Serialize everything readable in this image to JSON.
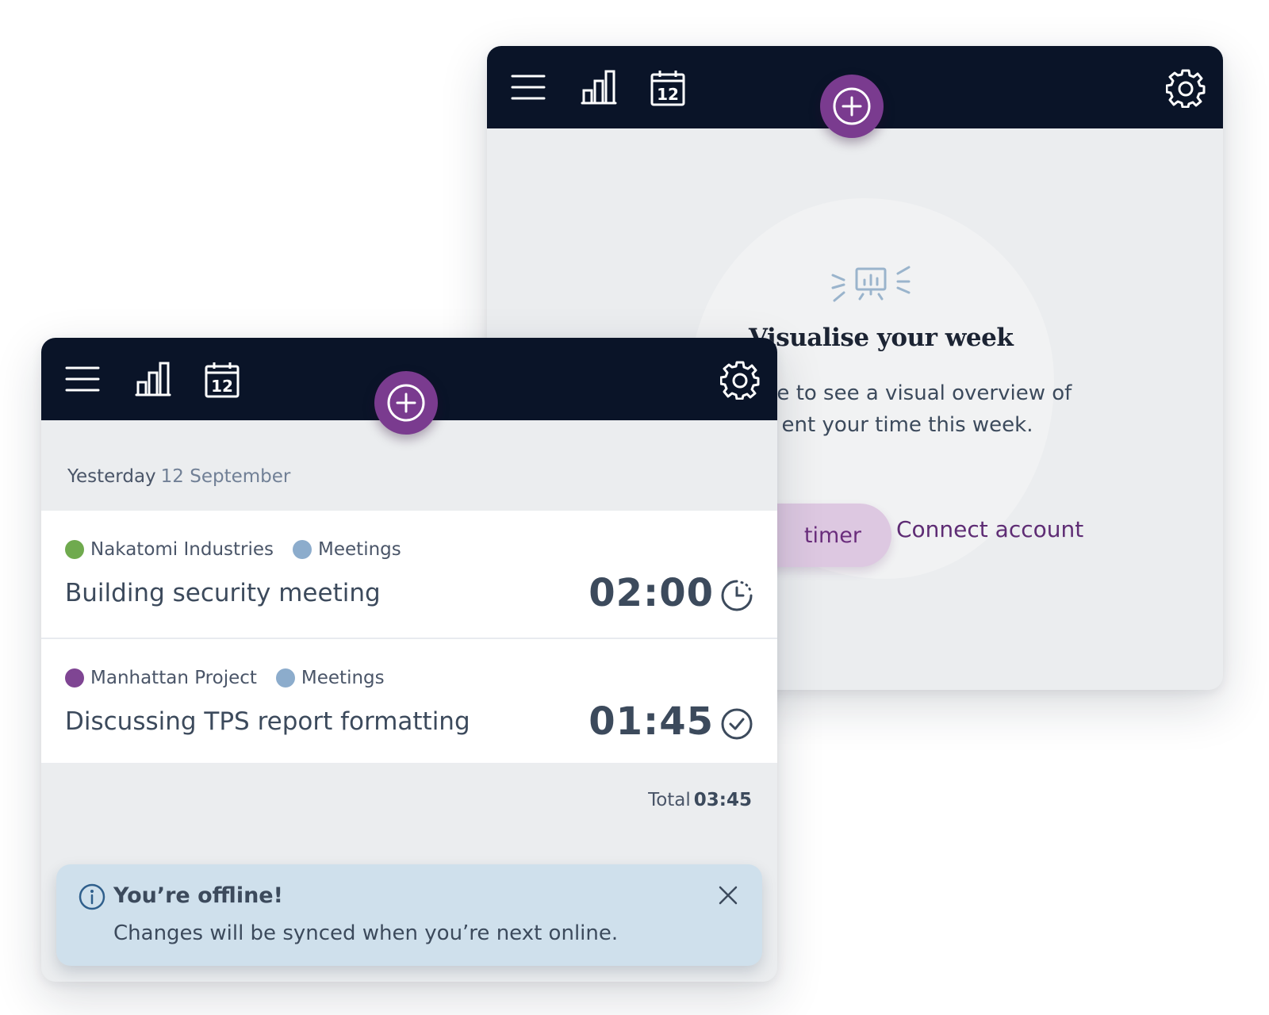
{
  "back_window": {
    "topbar": {
      "icons": [
        "menu-icon",
        "stats-icon",
        "calendar-icon",
        "add-icon",
        "gear-icon"
      ],
      "calendar_day": "12"
    },
    "empty_state": {
      "icon": "presentation-icon",
      "title": "Visualise your week",
      "text_line1": "time to see a visual overview of",
      "text_line2": "ent your time this week.",
      "primary_button": "timer",
      "link": "Connect account"
    }
  },
  "front_window": {
    "topbar": {
      "icons": [
        "menu-icon",
        "stats-icon",
        "calendar-icon",
        "add-icon",
        "gear-icon"
      ],
      "calendar_day": "12"
    },
    "day_header": {
      "relative": "Yesterday",
      "date": "12 September"
    },
    "entries": [
      {
        "client": "Nakatomi Industries",
        "client_color": "#6faa4e",
        "category": "Meetings",
        "category_color": "#8caccc",
        "title": "Building security meeting",
        "duration": "02:00",
        "status_icon": "timer-running-icon"
      },
      {
        "client": "Manhattan Project",
        "client_color": "#7f4593",
        "category": "Meetings",
        "category_color": "#8caccc",
        "title": "Discussing TPS report formatting",
        "duration": "01:45",
        "status_icon": "check-circle-icon"
      }
    ],
    "total": {
      "label": "Total",
      "value": "03:45"
    },
    "toast": {
      "icon": "info-icon",
      "title": "You’re offline!",
      "message": "Changes will be synced when you’re next online."
    }
  },
  "colors": {
    "topbar": "#0a1428",
    "accent": "#7a3b8f",
    "panel": "#ebedef",
    "toast": "#cfe0ec"
  }
}
